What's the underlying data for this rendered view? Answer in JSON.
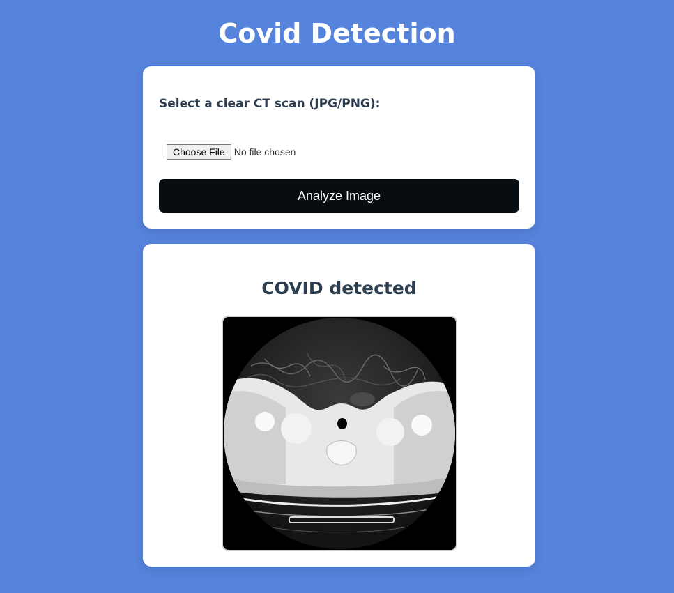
{
  "header": {
    "title": "Covid Detection"
  },
  "upload": {
    "label": "Select a clear CT scan (JPG/PNG):",
    "choose_file_label": "Choose File",
    "file_status": "No file chosen",
    "analyze_label": "Analyze Image"
  },
  "result": {
    "heading": "COVID detected",
    "image_description": "CT scan preview"
  },
  "colors": {
    "background": "#5683dc",
    "card": "#ffffff",
    "button": "#080d12",
    "heading_text": "#2c3e50"
  }
}
